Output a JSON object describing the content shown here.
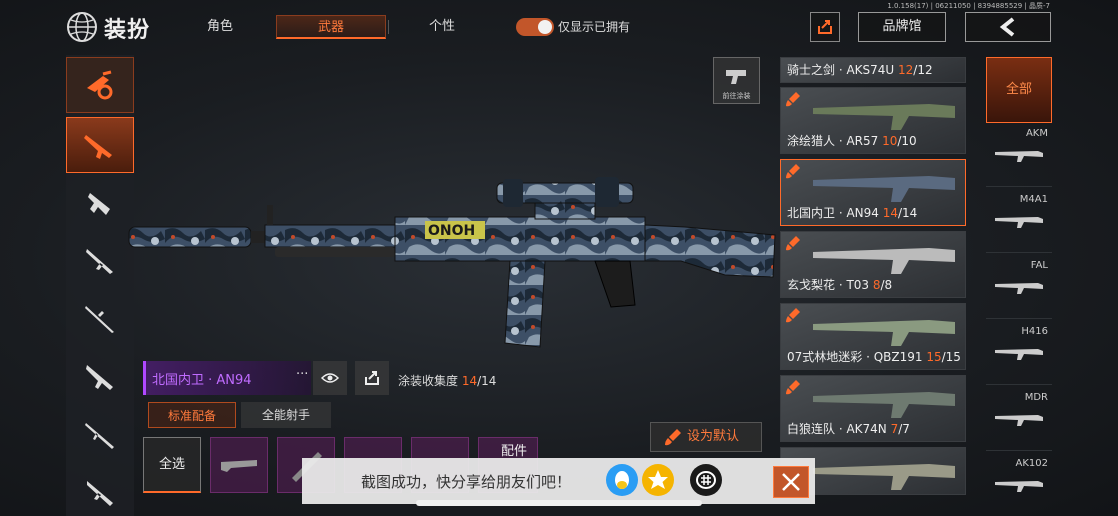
{
  "version": "1.0.158(17) | 06211050 | 8394885529 | 晶质-7",
  "header": {
    "title": "装扮",
    "tabs": [
      "角色",
      "武器",
      "个性"
    ],
    "active_tab": "武器",
    "toggle_label": "仅显示已拥有",
    "toggle_on": true,
    "brand_label": "品牌馆"
  },
  "left_categories": [
    "special-icon",
    "assault-rifle-icon",
    "smg-icon",
    "shotgun-icon",
    "sniper-icon",
    "lmg-icon",
    "marksman-icon",
    "pistol-icon"
  ],
  "paint_button_label": "前往涂装",
  "current_skin": {
    "name": "北国内卫 · AN94",
    "more": "···",
    "collection_label": "涂装收集度",
    "collected": "14",
    "total": "/14"
  },
  "sub_tabs": [
    "标准配备",
    "全能射手"
  ],
  "select_all": "全选",
  "attachments_label": "配件",
  "set_default": "设为默认",
  "skins": [
    {
      "name": "骑士之剑 · AKS74U ",
      "count": "12",
      "total": "/12"
    },
    {
      "name": "涂绘猎人 · AR57 ",
      "count": "10",
      "total": "/10"
    },
    {
      "name": "北国内卫 · AN94 ",
      "count": "14",
      "total": "/14"
    },
    {
      "name": "玄戈梨花 · T03 ",
      "count": "8",
      "total": "/8"
    },
    {
      "name": "07式林地迷彩 · QBZ191 ",
      "count": "15",
      "total": "/15"
    },
    {
      "name": "白狼连队 · AK74N ",
      "count": "7",
      "total": "/7"
    }
  ],
  "weapon_types": {
    "all_label": "全部",
    "items": [
      "AKM",
      "M4A1",
      "FAL",
      "H416",
      "MDR",
      "AK102"
    ]
  },
  "toast": {
    "text": "截图成功，快分享给朋友们吧！"
  },
  "colors": {
    "accent": "#ff6a2a",
    "epic": "#c06cff"
  }
}
